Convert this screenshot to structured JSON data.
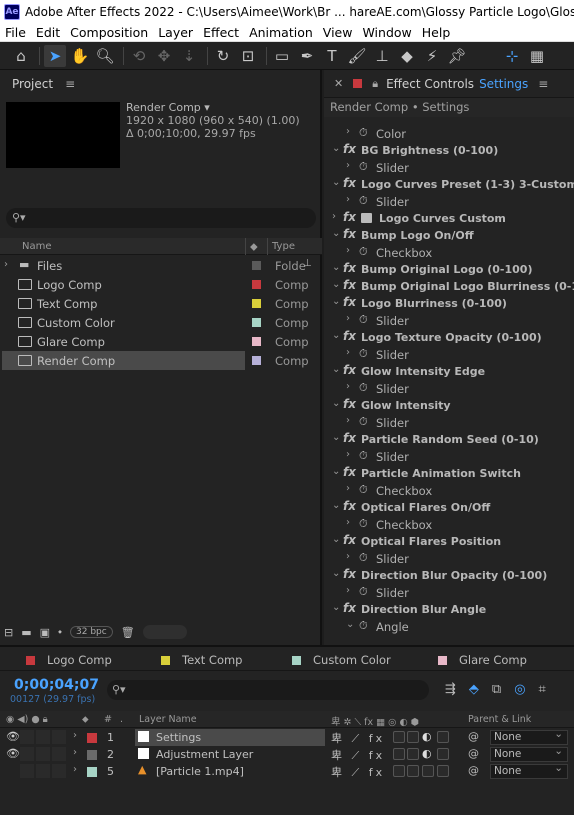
{
  "window": {
    "title": "Adobe After Effects 2022 - C:\\Users\\Aimee\\Work\\Br ... hareAE.com\\Glossy Particle Logo\\Glossy Particle L",
    "app_icon": "Ae"
  },
  "menu": [
    "File",
    "Edit",
    "Composition",
    "Layer",
    "Effect",
    "Animation",
    "View",
    "Window",
    "Help"
  ],
  "project": {
    "title": "Project",
    "comp_name": "Render Comp ▾",
    "comp_res": "1920 x 1080  (960 x 540) (1.00)",
    "comp_dur": "Δ 0;00;10;00, 29.97 fps",
    "search_placeholder": "",
    "col_name": "Name",
    "col_type": "Type",
    "items": [
      {
        "name": "Files",
        "type": "Folde",
        "color": "#5a5a5a",
        "kind": "folder"
      },
      {
        "name": "Logo Comp",
        "type": "Comp",
        "color": "#c8393e",
        "kind": "comp"
      },
      {
        "name": "Text Comp",
        "type": "Comp",
        "color": "#d9cf3a",
        "kind": "comp"
      },
      {
        "name": "Custom Color",
        "type": "Comp",
        "color": "#a7d4c6",
        "kind": "comp"
      },
      {
        "name": "Glare Comp",
        "type": "Comp",
        "color": "#e8b8c8",
        "kind": "comp"
      },
      {
        "name": "Render Comp",
        "type": "Comp",
        "color": "#b6b0d8",
        "kind": "comp",
        "selected": true
      }
    ],
    "bpc": "32 bpc"
  },
  "effects": {
    "panel_title": "Effect Controls",
    "layer_tab": "Settings",
    "breadcrumb": "Render Comp • Settings",
    "rows": [
      {
        "t": "sub",
        "name": "Color"
      },
      {
        "t": "fx",
        "name": "BG Brightness (0-100)"
      },
      {
        "t": "sub",
        "name": "Slider"
      },
      {
        "t": "fx",
        "name": "Logo Curves Preset (1-3) 3-Custom"
      },
      {
        "t": "sub",
        "name": "Slider"
      },
      {
        "t": "fxc",
        "name": "Logo Curves Custom"
      },
      {
        "t": "fx",
        "name": "Bump Logo On/Off"
      },
      {
        "t": "sub",
        "name": "Checkbox"
      },
      {
        "t": "fx",
        "name": "Bump Original Logo (0-100)"
      },
      {
        "t": "fx",
        "name": "Bump Original Logo Blurriness (0-100)"
      },
      {
        "t": "fx",
        "name": "Logo Blurriness (0-100)"
      },
      {
        "t": "sub",
        "name": "Slider"
      },
      {
        "t": "fx",
        "name": "Logo Texture Opacity (0-100)"
      },
      {
        "t": "sub",
        "name": "Slider"
      },
      {
        "t": "fx",
        "name": "Glow Intensity Edge"
      },
      {
        "t": "sub",
        "name": "Slider"
      },
      {
        "t": "fx",
        "name": "Glow Intensity"
      },
      {
        "t": "sub",
        "name": "Slider"
      },
      {
        "t": "fx",
        "name": "Particle Random Seed (0-10)"
      },
      {
        "t": "sub",
        "name": "Slider"
      },
      {
        "t": "fx",
        "name": "Particle Animation Switch"
      },
      {
        "t": "sub",
        "name": "Checkbox"
      },
      {
        "t": "fx",
        "name": "Optical Flares On/Off"
      },
      {
        "t": "sub",
        "name": "Checkbox"
      },
      {
        "t": "fx",
        "name": "Optical Flares Position"
      },
      {
        "t": "sub",
        "name": "Slider"
      },
      {
        "t": "fx",
        "name": "Direction Blur Opacity (0-100)"
      },
      {
        "t": "sub",
        "name": "Slider"
      },
      {
        "t": "fx",
        "name": "Direction Blur Angle"
      },
      {
        "t": "subo",
        "name": "Angle"
      }
    ]
  },
  "timeline": {
    "tabs": [
      {
        "name": "Logo Comp",
        "color": "#c8393e"
      },
      {
        "name": "Text Comp",
        "color": "#d9cf3a"
      },
      {
        "name": "Custom Color",
        "color": "#a7d4c6"
      },
      {
        "name": "Glare Comp",
        "color": "#e8b8c8"
      }
    ],
    "timecode": "0;00;04;07",
    "frames": "00127 (29.97 fps)",
    "col_layer_name": "Layer Name",
    "col_parent": "Parent & Link",
    "layers": [
      {
        "num": "1",
        "name": "Settings",
        "color": "#c8393e",
        "icon": "solid",
        "visible": true,
        "selected": true,
        "parent": "None"
      },
      {
        "num": "2",
        "name": "Adjustment Layer",
        "color": "#6a6a6a",
        "icon": "solid",
        "visible": true,
        "parent": "None"
      },
      {
        "num": "5",
        "name": "[Particle 1.mp4]",
        "color": "#a7d4c6",
        "icon": "video",
        "visible": false,
        "parent": "None"
      }
    ]
  }
}
